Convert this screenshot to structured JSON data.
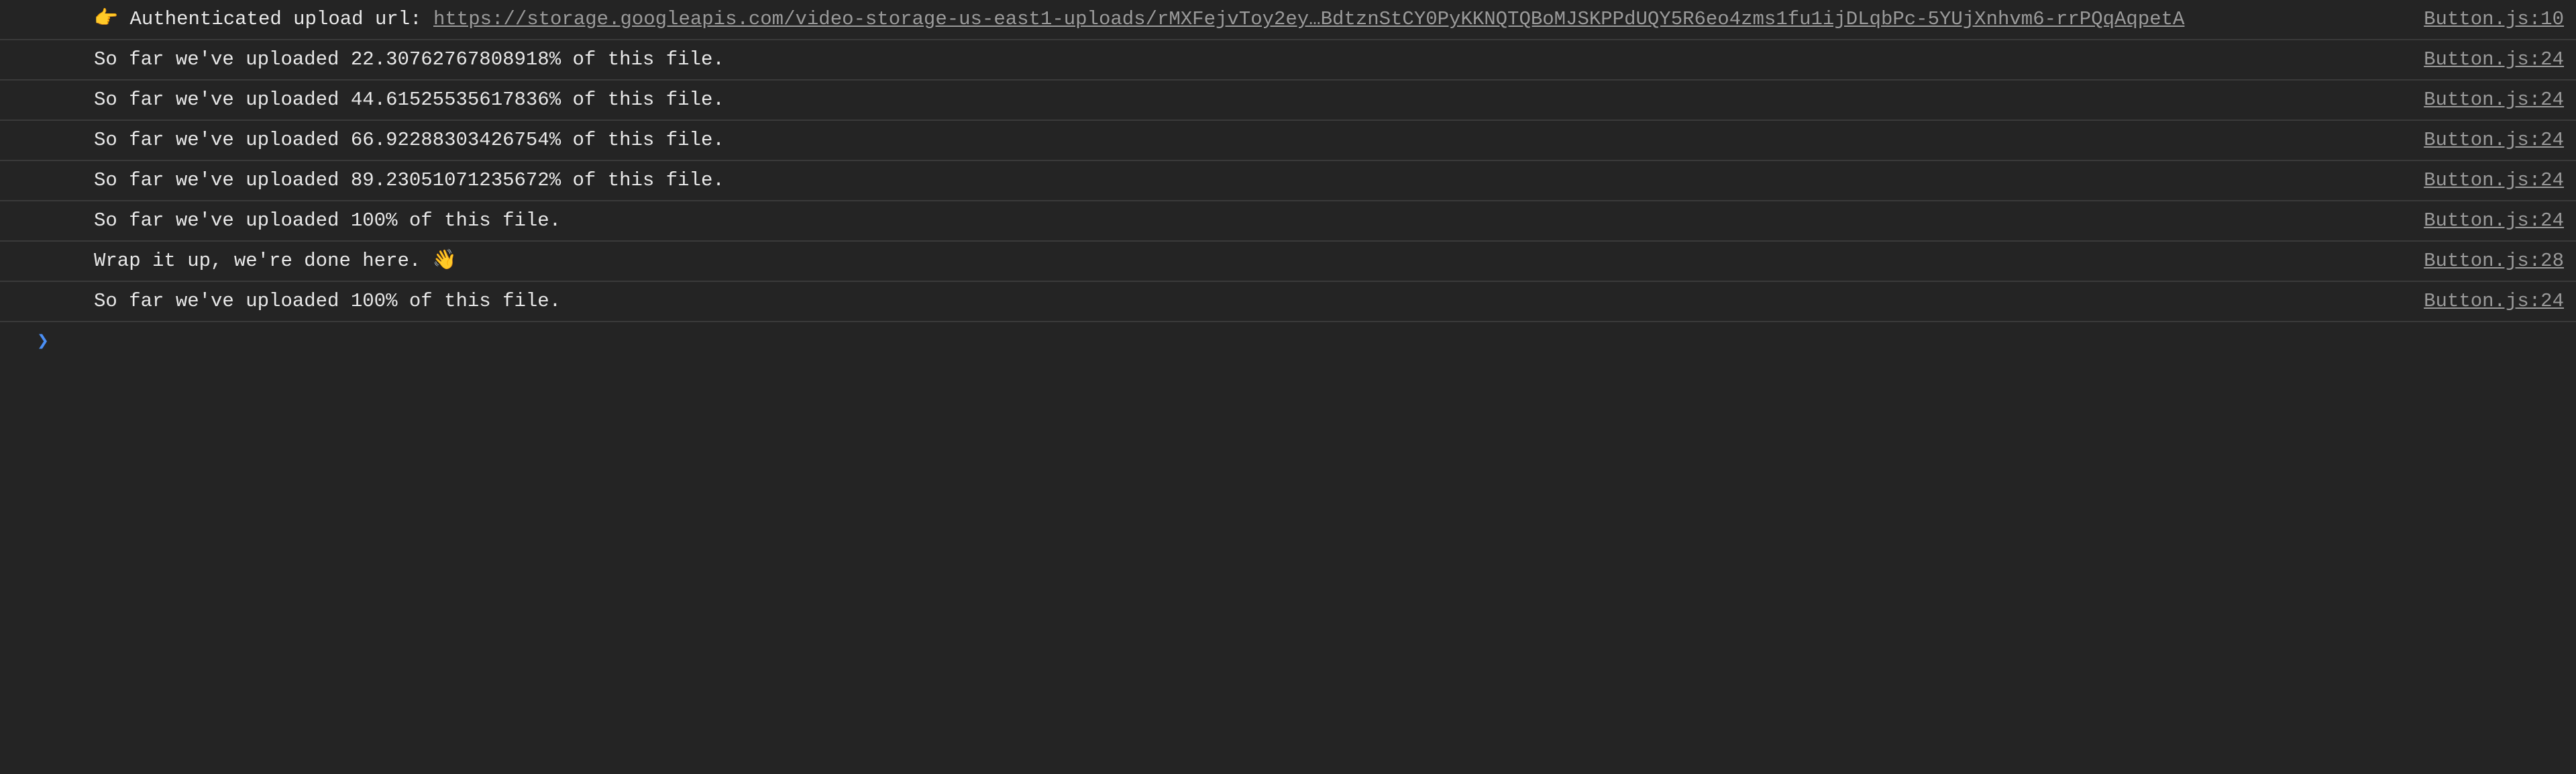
{
  "console": {
    "first_entry": {
      "emoji": "👉",
      "prefix": " Authenticated upload url: ",
      "url": "https://storage.googleapis.com/video-storage-us-east1-uploads/rMXFejvToy2ey…BdtznStCY0PyKKNQTQBoMJSKPPdUQY5R6eo4zms1fu1ijDLqbPc-5YUjXnhvm6-rrPQqAqpetA",
      "source": "Button.js:10"
    },
    "progress_entries": [
      {
        "text": "So far we've uploaded 22.30762767808918% of this file.",
        "source": "Button.js:24"
      },
      {
        "text": "So far we've uploaded 44.61525535617836% of this file.",
        "source": "Button.js:24"
      },
      {
        "text": "So far we've uploaded 66.92288303426754% of this file.",
        "source": "Button.js:24"
      },
      {
        "text": "So far we've uploaded 89.23051071235672% of this file.",
        "source": "Button.js:24"
      },
      {
        "text": "So far we've uploaded 100% of this file.",
        "source": "Button.js:24"
      },
      {
        "text": "Wrap it up, we're done here. 👋",
        "source": "Button.js:28"
      },
      {
        "text": "So far we've uploaded 100% of this file.",
        "source": "Button.js:24"
      }
    ],
    "prompt_symbol": "❯"
  }
}
